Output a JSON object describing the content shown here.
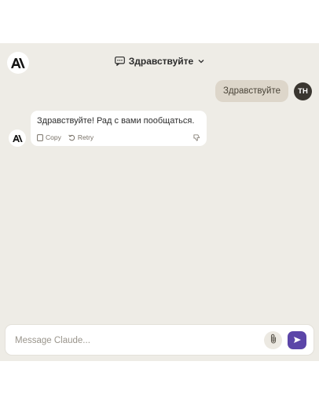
{
  "header": {
    "logo_icon": "anthropic-logo-icon",
    "conversation_title": "Здравствуйте",
    "title_icon": "chat-bubble-icon",
    "title_dropdown_icon": "chevron-down-icon"
  },
  "messages": {
    "user": {
      "text": "Здравствуйте",
      "avatar_initials": "TH"
    },
    "assistant": {
      "text": "Здравствуйте! Рад с вами пообщаться.",
      "actions": {
        "copy_label": "Copy",
        "retry_label": "Retry"
      }
    }
  },
  "composer": {
    "placeholder": "Message Claude...",
    "value": ""
  },
  "colors": {
    "background": "#eeece6",
    "user_bubble": "#ddd6ca",
    "send_button": "#5b45a8",
    "user_avatar": "#3a3630"
  }
}
